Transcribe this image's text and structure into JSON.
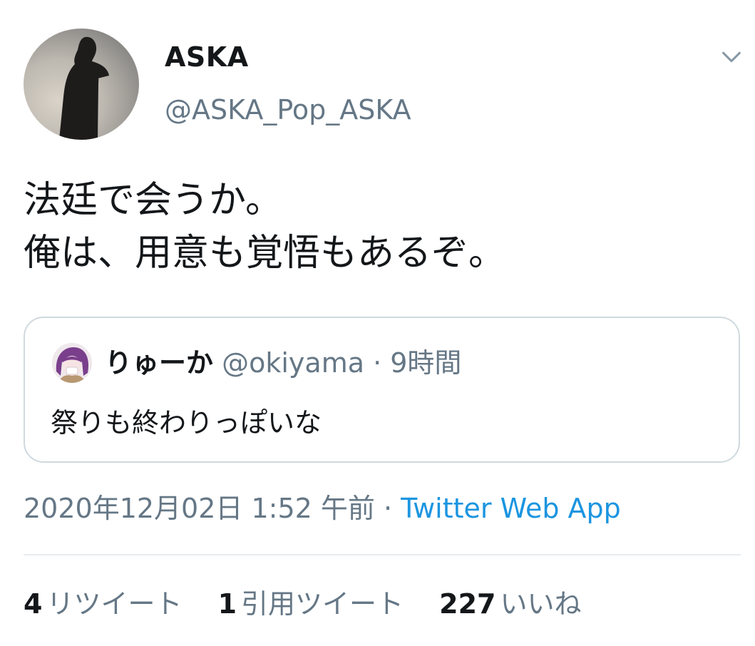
{
  "tweet": {
    "author": {
      "display_name": "ASKA",
      "handle": "@ASKA_Pop_ASKA"
    },
    "text": "法廷で会うか。\n俺は、用意も覚悟もあるぞ。",
    "quoted": {
      "display_name": "りゅーか",
      "handle": "@okiyama",
      "separator": " · ",
      "time": "9時間",
      "text": "祭りも終わりっぽいな"
    },
    "meta": {
      "datetime": "2020年12月02日 1:52 午前",
      "separator": " · ",
      "source": "Twitter Web App"
    },
    "stats": {
      "retweets_count": "4",
      "retweets_label": "リツイート",
      "quotes_count": "1",
      "quotes_label": "引用ツイート",
      "likes_count": "227",
      "likes_label": "いいね"
    }
  },
  "icons": {
    "more": "chevron-down-icon"
  },
  "colors": {
    "text_primary": "#14171a",
    "text_secondary": "#657786",
    "link": "#1b95e0",
    "border": "#cfd9de",
    "divider": "#e6ecf0"
  }
}
